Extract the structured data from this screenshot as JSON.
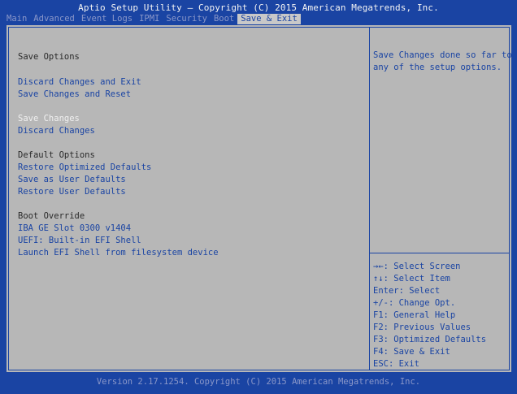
{
  "title": "Aptio Setup Utility – Copyright (C) 2015 American Megatrends, Inc.",
  "tabs": [
    "Main",
    "Advanced",
    "Event Logs",
    "IPMI",
    "Security",
    "Boot",
    "Save & Exit"
  ],
  "active_tab": "Save & Exit",
  "left": {
    "save_options": "Save Options",
    "discard_exit": "Discard Changes and Exit",
    "save_reset": "Save Changes and Reset",
    "save_changes": "Save Changes",
    "discard_changes": "Discard Changes",
    "default_options": "Default Options",
    "restore_optimized": "Restore Optimized Defaults",
    "save_user": "Save as User Defaults",
    "restore_user": "Restore User Defaults",
    "boot_override": "Boot Override",
    "iba": "IBA GE Slot 0300 v1404",
    "uefi_shell": "UEFI: Built-in EFI Shell",
    "launch_efi": "Launch EFI Shell from filesystem device"
  },
  "help": {
    "line1": "Save Changes done so far to",
    "line2": "any of the setup options."
  },
  "keys": [
    "→←: Select Screen",
    "↑↓: Select Item",
    "Enter: Select",
    "+/-: Change Opt.",
    "F1: General Help",
    "F2: Previous Values",
    "F3: Optimized Defaults",
    "F4: Save & Exit",
    "ESC: Exit"
  ],
  "footer": "Version 2.17.1254. Copyright (C) 2015 American Megatrends, Inc.",
  "colors": {
    "background": "#1a44a3",
    "panel": "#b7b7b7",
    "selected_text": "#f0f0f0",
    "option_text": "#1a44a3"
  }
}
